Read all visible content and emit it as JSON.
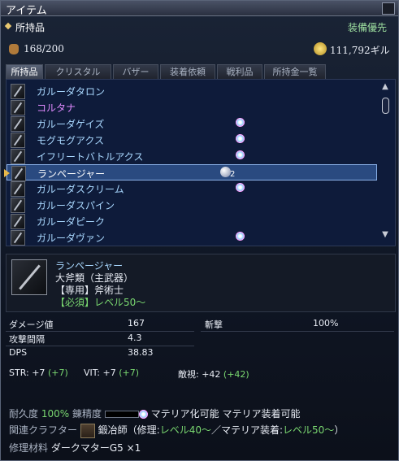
{
  "window": {
    "title": "アイテム"
  },
  "header": {
    "inventory_label": "所持品",
    "sort_label": "装備優先",
    "count": "168/200",
    "gil": "111,792ギル"
  },
  "tabs": [
    "所持品",
    "クリスタル",
    "バザー",
    "装着依頼",
    "戦利品",
    "所持金一覧"
  ],
  "items": [
    {
      "name": "ガルーダタロン",
      "color": "blue",
      "materia": false
    },
    {
      "name": "コルタナ",
      "color": "purple",
      "materia": false
    },
    {
      "name": "ガルーダゲイズ",
      "color": "blue",
      "materia": true
    },
    {
      "name": "モグモグアクス",
      "color": "blue",
      "materia": true
    },
    {
      "name": "イフリートバトルアクス",
      "color": "blue",
      "materia": true
    },
    {
      "name": "ランページャー",
      "color": "blue",
      "materia": false,
      "selected": true,
      "orb_count": "2"
    },
    {
      "name": "ガルーダスクリーム",
      "color": "blue",
      "materia": true
    },
    {
      "name": "ガルーダスパイン",
      "color": "blue",
      "materia": false
    },
    {
      "name": "ガルーダピーク",
      "color": "blue",
      "materia": false
    },
    {
      "name": "ガルーダヴァン",
      "color": "blue",
      "materia": true
    }
  ],
  "detail": {
    "name": "ランページャー",
    "category": "大斧類（主武器）",
    "job": "【専用】斧術士",
    "requirement": "【必須】レベル50～"
  },
  "stats": {
    "damage_label": "ダメージ値",
    "damage_value": "167",
    "slash_label": "斬撃",
    "slash_value": "100%",
    "delay_label": "攻撃間隔",
    "delay_value": "4.3",
    "dps_label": "DPS",
    "dps_value": "38.83"
  },
  "bonus": {
    "str": "STR: +7",
    "str_hq": "(+7)",
    "vit": "VIT: +7",
    "vit_hq": "(+7)",
    "enmity": "敵視: +42",
    "enmity_hq": "(+42)"
  },
  "footer": {
    "durability_label": "耐久度",
    "durability_value": "100%",
    "spiritbond_label": "錬精度",
    "materia_convert": "マテリア化可能",
    "materia_meld": "マテリア装着可能",
    "crafter_label": "関連クラフター",
    "crafter_text_a": "鍛冶師（修理:",
    "crafter_level_a": "レベル40～",
    "crafter_text_b": "／マテリア装着:",
    "crafter_level_b": "レベル50～",
    "crafter_text_c": "）",
    "repair_label": "修理材料",
    "repair_value": "ダークマターG5 ×1"
  }
}
